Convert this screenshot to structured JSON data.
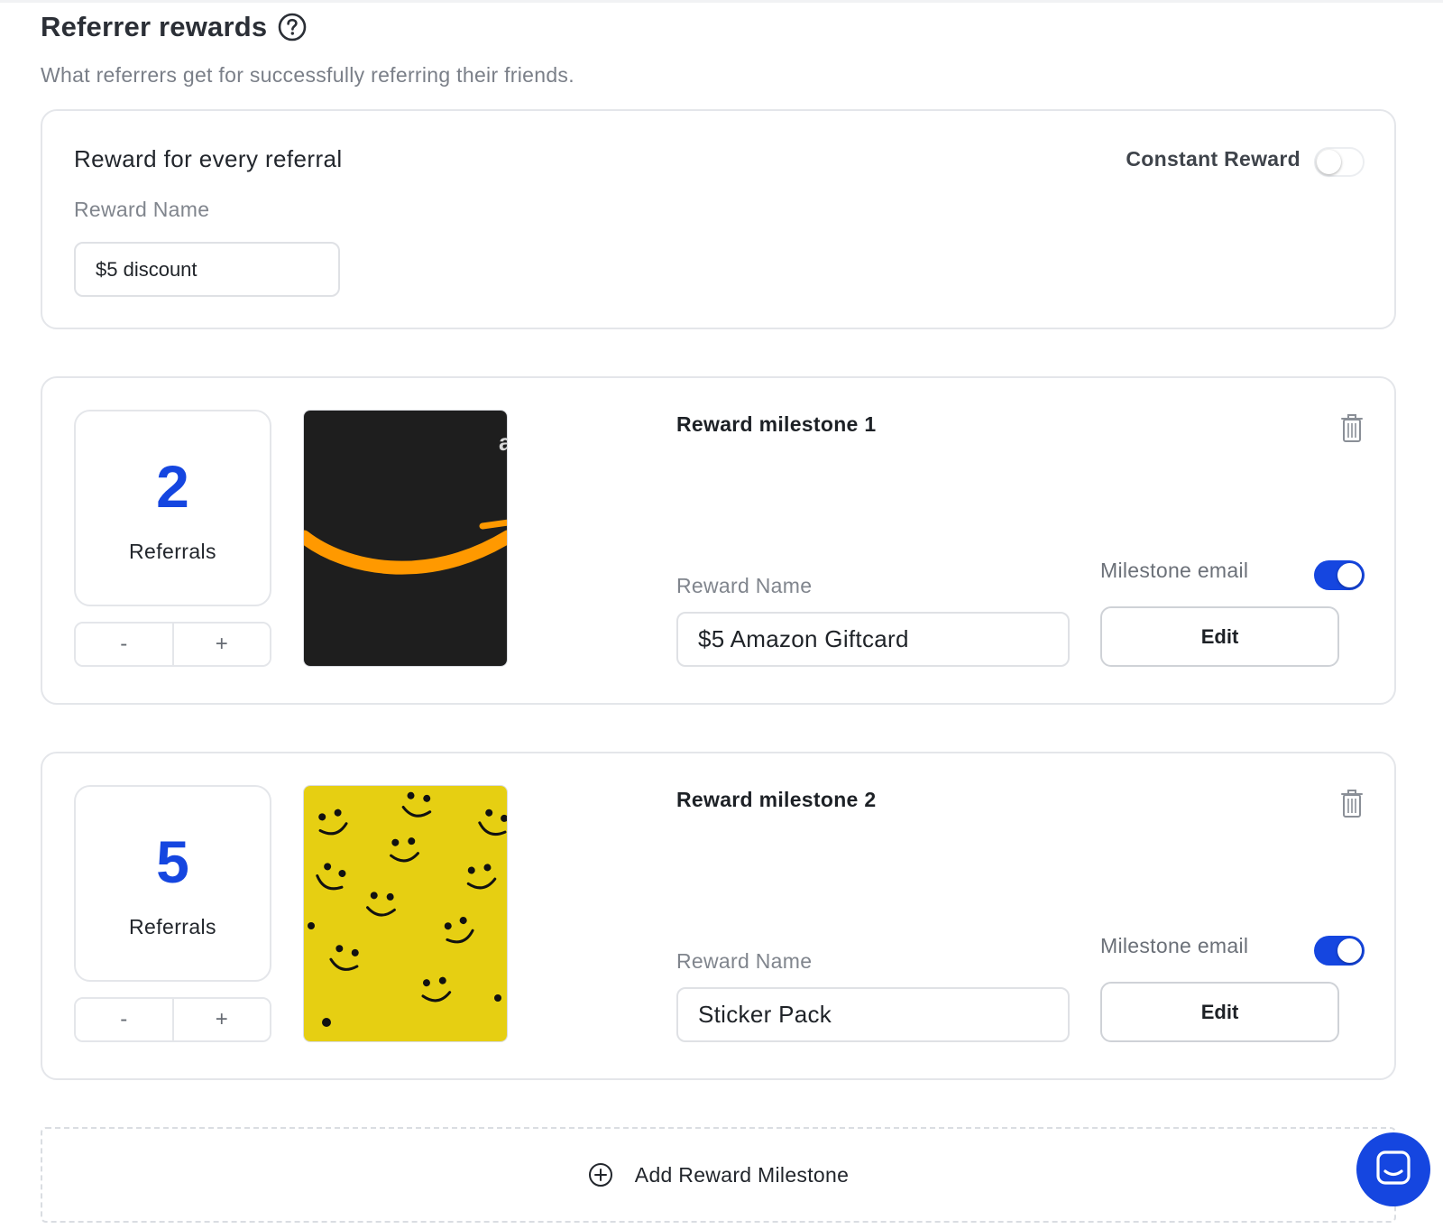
{
  "header": {
    "title": "Referrer rewards",
    "subtitle": "What referrers get for successfully referring their friends."
  },
  "every_referral": {
    "title": "Reward for every referral",
    "reward_name_label": "Reward Name",
    "reward_name_value": "$5 discount",
    "constant_reward_label": "Constant Reward",
    "constant_reward_enabled": false
  },
  "milestones": [
    {
      "count": "2",
      "count_label": "Referrals",
      "decrement_label": "-",
      "increment_label": "+",
      "image": "amazon-giftcard-image",
      "title": "Reward milestone 1",
      "reward_name_label": "Reward Name",
      "reward_name_value": "$5 Amazon Giftcard",
      "email_label": "Milestone email",
      "email_enabled": true,
      "edit_label": "Edit"
    },
    {
      "count": "5",
      "count_label": "Referrals",
      "decrement_label": "-",
      "increment_label": "+",
      "image": "smiley-stickers-image",
      "title": "Reward milestone 2",
      "reward_name_label": "Reward Name",
      "reward_name_value": "Sticker Pack",
      "email_label": "Milestone email",
      "email_enabled": true,
      "edit_label": "Edit"
    }
  ],
  "add_milestone": {
    "label": "Add Reward Milestone"
  },
  "colors": {
    "accent": "#1546e0",
    "border": "#e4e6ea",
    "muted_text": "#80858d",
    "amazon_card": "#1e1e1e",
    "amazon_smile": "#ff9900",
    "sticker_yellow": "#e6cf12"
  },
  "icons": {
    "help": "question-circle-icon",
    "trash": "trash-icon",
    "add": "plus-circle-icon",
    "chat": "chat-icon"
  }
}
